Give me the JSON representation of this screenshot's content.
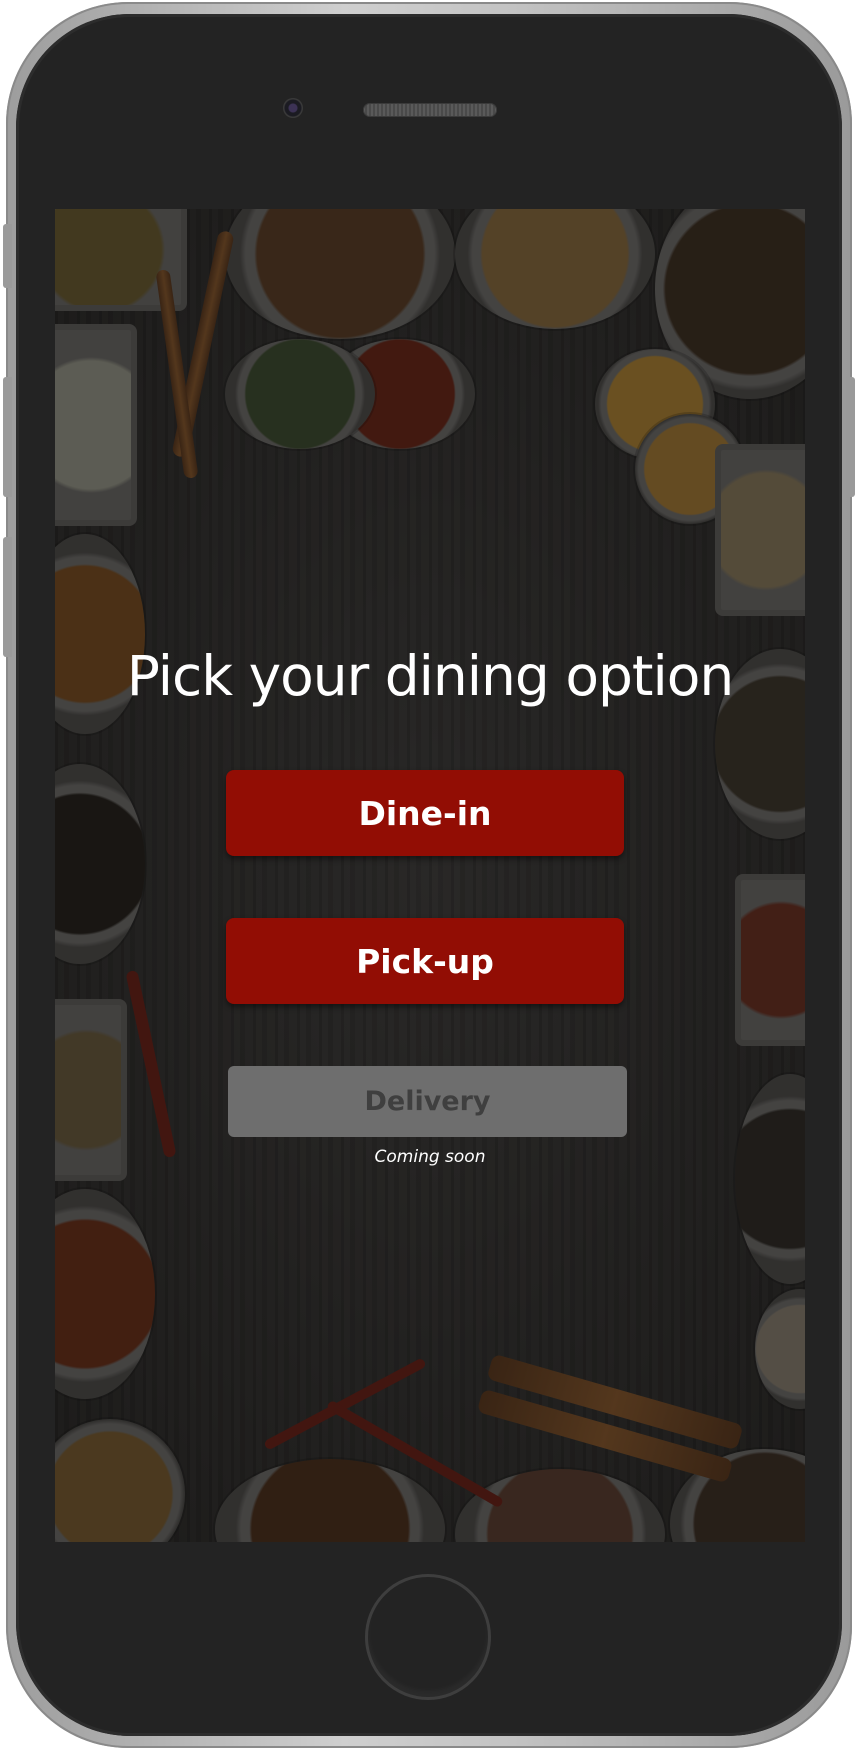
{
  "screen": {
    "title": "Pick your dining option",
    "options": {
      "dine_in": "Dine-in",
      "pick_up": "Pick-up",
      "delivery": "Delivery",
      "delivery_note": "Coming soon"
    }
  },
  "colors": {
    "primary_button": "#920d04",
    "disabled_button": "#6e6e6e"
  }
}
